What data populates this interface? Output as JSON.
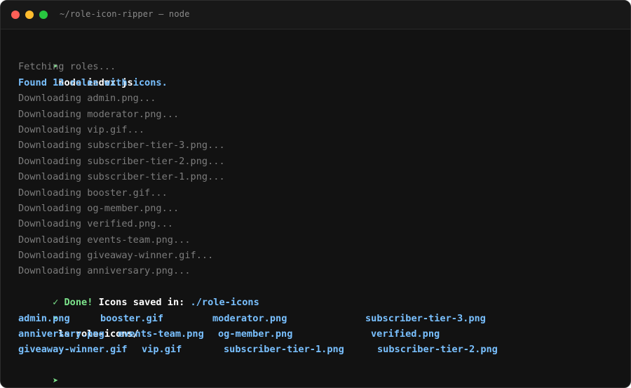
{
  "window": {
    "title": "~/role-icon-ripper — node"
  },
  "prompt_symbol": "➤",
  "terminal": {
    "command1": "node index.js",
    "fetching": "Fetching roles...",
    "found": "Found 12 roles with icons.",
    "downloads": [
      "Downloading admin.png...",
      "Downloading moderator.png...",
      "Downloading vip.gif...",
      "Downloading subscriber-tier-3.png...",
      "Downloading subscriber-tier-2.png...",
      "Downloading subscriber-tier-1.png...",
      "Downloading booster.gif...",
      "Downloading og-member.png...",
      "Downloading verified.png...",
      "Downloading events-team.png...",
      "Downloading giveaway-winner.gif...",
      "Downloading anniversary.png..."
    ],
    "done_check": "✓",
    "done_label": "Done!",
    "done_text": "Icons saved in:",
    "done_path": "./role-icons",
    "command2": "ls role-icons/",
    "ls_rows": [
      [
        "admin.png",
        "booster.gif",
        "moderator.png",
        "subscriber-tier-3.png"
      ],
      [
        "anniversary.png",
        "events-team.png",
        "og-member.png",
        "verified.png"
      ],
      [
        "giveaway-winner.gif",
        "vip.gif",
        "subscriber-tier-1.png",
        "subscriber-tier-2.png"
      ]
    ]
  },
  "colors": {
    "background": "#121212",
    "prompt": "#7ce38b",
    "info": "#79c0ff",
    "dim": "#7c7c7c"
  }
}
